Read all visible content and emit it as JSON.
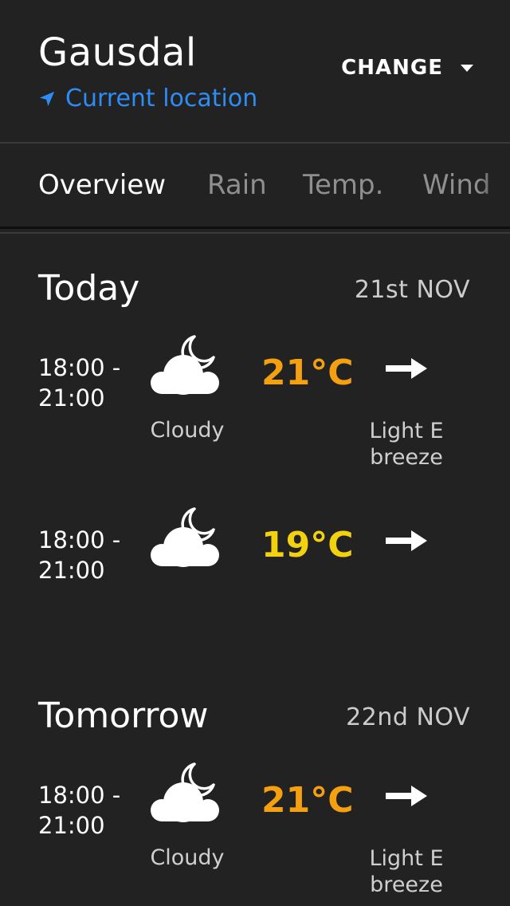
{
  "header": {
    "city": "Gausdal",
    "location_label": "Current location",
    "change_label": "CHANGE"
  },
  "tabs": [
    {
      "label": "Overview",
      "active": true
    },
    {
      "label": "Rain",
      "active": false
    },
    {
      "label": "Temp.",
      "active": false
    },
    {
      "label": "Wind",
      "active": false
    }
  ],
  "days": [
    {
      "title": "Today",
      "date": "21st NOV",
      "slots": [
        {
          "time": "18:00 -\n21:00",
          "icon": "cloudy-night-icon",
          "temp": "21°C",
          "temp_color": "#f5a011",
          "wind_direction": "E",
          "condition": "Cloudy",
          "wind": "Light E breeze"
        },
        {
          "time": "18:00 -\n21:00",
          "icon": "cloudy-night-icon",
          "temp": "19°C",
          "temp_color": "#f2d20e",
          "wind_direction": "E",
          "condition": "",
          "wind": ""
        }
      ]
    },
    {
      "title": "Tomorrow",
      "date": "22nd NOV",
      "slots": [
        {
          "time": "18:00 -\n21:00",
          "icon": "cloudy-night-icon",
          "temp": "21°C",
          "temp_color": "#f5a011",
          "wind_direction": "E",
          "condition": "Cloudy",
          "wind": "Light E breeze"
        }
      ]
    }
  ],
  "colors": {
    "background": "#222222",
    "accent_blue": "#2e8cf5",
    "muted_text": "#cfcfcf"
  }
}
